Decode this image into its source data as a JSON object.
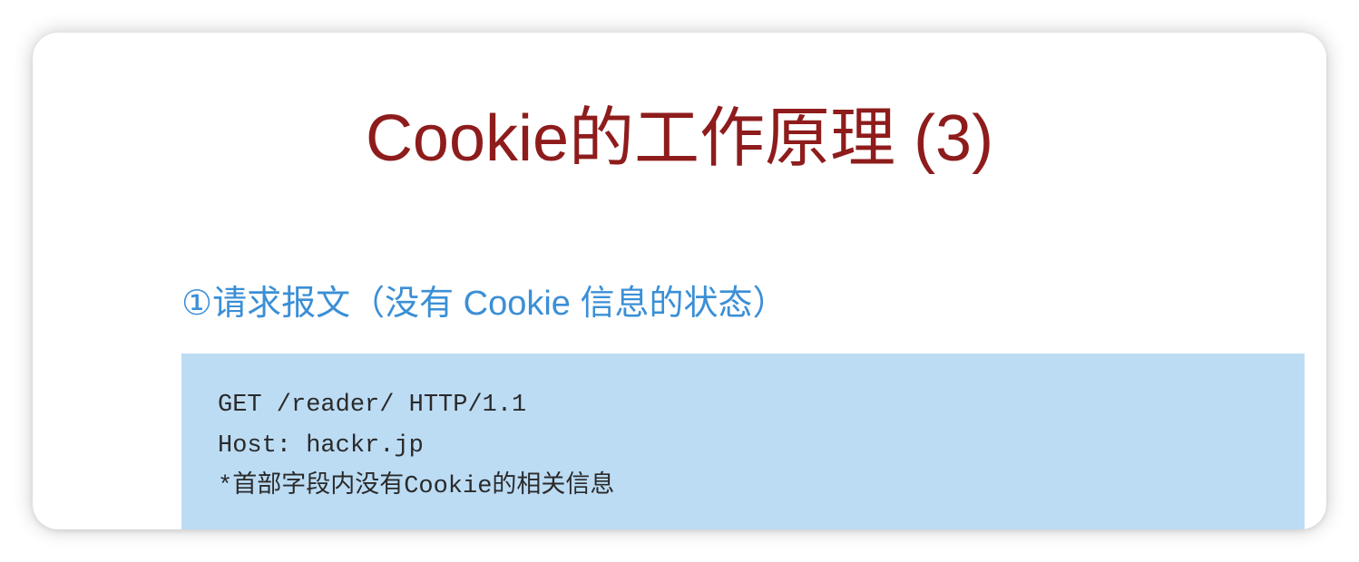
{
  "slide": {
    "title": "Cookie的工作原理 (3)",
    "section_heading": "①请求报文（没有 Cookie 信息的状态）",
    "request_lines": [
      "GET /reader/ HTTP/1.1",
      "Host: hackr.jp",
      "*首部字段内没有Cookie的相关信息"
    ]
  },
  "colors": {
    "title": "#8e1c1c",
    "heading": "#3b8fd6",
    "code_background": "#bcdcf4"
  }
}
